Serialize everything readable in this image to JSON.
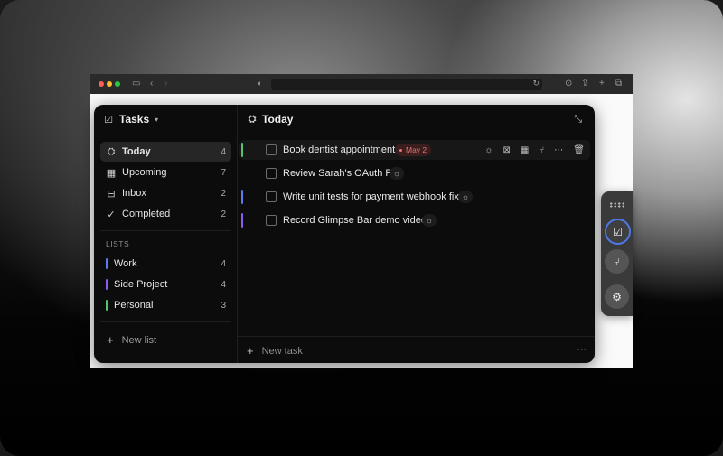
{
  "sidebar": {
    "title": "Tasks",
    "nav": [
      {
        "label": "Today",
        "count": "4",
        "icon": "today-icon"
      },
      {
        "label": "Upcoming",
        "count": "7",
        "icon": "calendar-icon"
      },
      {
        "label": "Inbox",
        "count": "2",
        "icon": "inbox-icon"
      },
      {
        "label": "Completed",
        "count": "2",
        "icon": "check-double-icon"
      }
    ],
    "lists_heading": "LISTS",
    "lists": [
      {
        "label": "Work",
        "count": "4",
        "color": "#5b7cf0"
      },
      {
        "label": "Side Project",
        "count": "4",
        "color": "#8a5cf0"
      },
      {
        "label": "Personal",
        "count": "3",
        "color": "#55c46a"
      }
    ],
    "new_list": "New list"
  },
  "main": {
    "title": "Today",
    "tasks": [
      {
        "title": "Book dentist appointment",
        "date": "May 2",
        "bar_color": "#55c46a"
      },
      {
        "title": "Review Sarah's OAuth PR",
        "bar_color": ""
      },
      {
        "title": "Write unit tests for payment webhook fix",
        "bar_color": "#5b7cf0"
      },
      {
        "title": "Record Glimpse Bar demo video",
        "bar_color": "#8a5cf0"
      }
    ],
    "new_task": "New task"
  },
  "colors": {
    "accent": "#4f78e6",
    "date_badge": "#e27474"
  }
}
